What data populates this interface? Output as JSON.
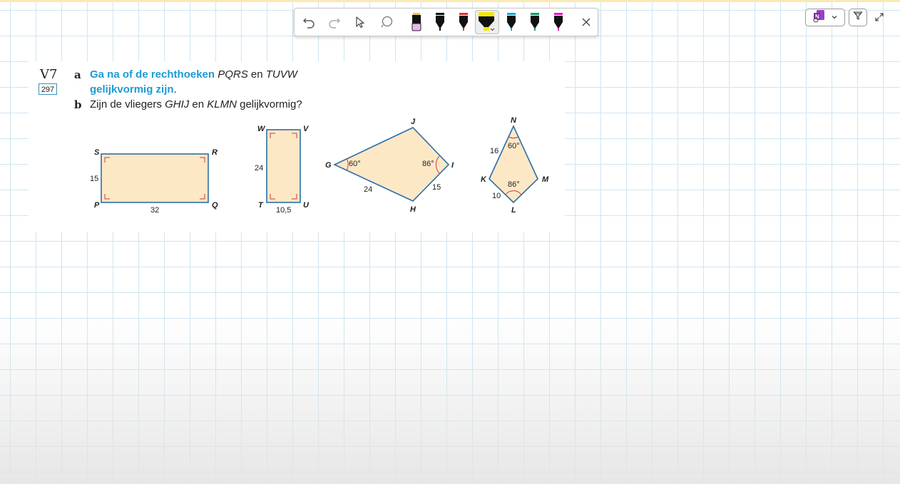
{
  "toolbar": {
    "tools": [
      {
        "name": "undo-icon"
      },
      {
        "name": "redo-icon"
      },
      {
        "name": "select-pointer-icon"
      },
      {
        "name": "lasso-icon"
      },
      {
        "name": "highlighter-pen-icon",
        "tip_color": "#e9b8f2"
      },
      {
        "name": "black-pen-icon",
        "tip_color": "#111111"
      },
      {
        "name": "red-pen-icon",
        "tip_color": "#e0303d"
      },
      {
        "name": "yellow-highlighter-icon",
        "tip_color": "#f5e800",
        "selected": true
      },
      {
        "name": "blue-pen-icon",
        "tip_color": "#18a8e0"
      },
      {
        "name": "green-pen-icon",
        "tip_color": "#12a060"
      },
      {
        "name": "magenta-pen-icon",
        "tip_color": "#e020c0"
      },
      {
        "name": "close-icon"
      }
    ]
  },
  "exercise": {
    "code": "V7",
    "page_ref": "297",
    "a_letter": "a",
    "a_blue_1": "Ga na of de rechthoeken",
    "a_it_1": "PQRS",
    "a_mid": "en",
    "a_it_2": "TUVW",
    "a_blue_2": "gelijkvormig zijn",
    "a_end": ".",
    "b_letter": "b",
    "b_pre": "Zijn de vliegers",
    "b_it_1": "GHIJ",
    "b_mid": "en",
    "b_it_2": "KLMN",
    "b_post": "gelijkvormig?"
  },
  "figures": {
    "fill": "#fde8c6",
    "stroke": "#2a6fa8",
    "mark": "#d23a3a",
    "pqrs": {
      "S": "S",
      "R": "R",
      "P": "P",
      "Q": "Q",
      "side_left": "15",
      "side_bottom": "32"
    },
    "tuvw": {
      "W": "W",
      "V": "V",
      "T": "T",
      "U": "U",
      "side_left": "24",
      "side_bottom": "10,5"
    },
    "ghij": {
      "G": "G",
      "H": "H",
      "I": "I",
      "J": "J",
      "angle_G": "60°",
      "angle_I": "86°",
      "side_GH": "24",
      "side_HI": "15"
    },
    "klmn": {
      "K": "K",
      "L": "L",
      "M": "M",
      "N": "N",
      "angle_N": "60°",
      "angle_L": "86°",
      "side_KN": "16",
      "side_KL": "10"
    }
  }
}
